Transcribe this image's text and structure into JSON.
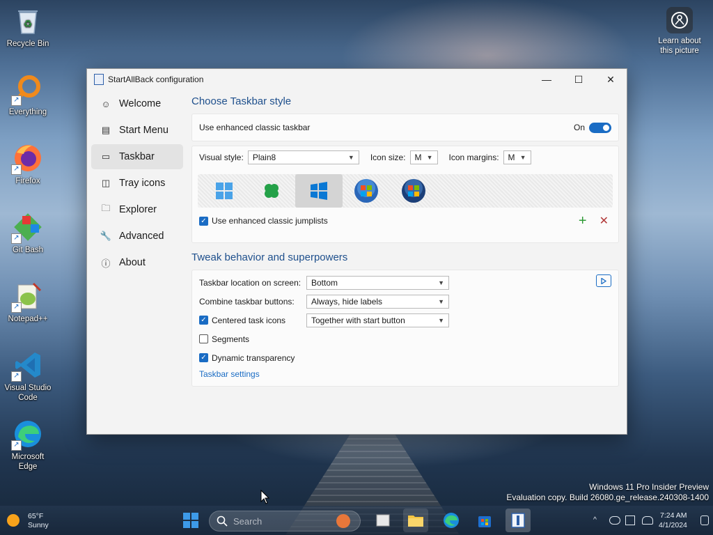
{
  "desktop": {
    "icons": [
      {
        "label": "Recycle Bin"
      },
      {
        "label": "Everything"
      },
      {
        "label": "Firefox"
      },
      {
        "label": "Git Bash"
      },
      {
        "label": "Notepad++"
      },
      {
        "label": "Visual Studio Code"
      },
      {
        "label": "Microsoft Edge"
      }
    ],
    "learn_label": "Learn about this picture",
    "watermark_line1": "Windows 11 Pro Insider Preview",
    "watermark_line2": "Evaluation copy. Build 26080.ge_release.240308-1400"
  },
  "window": {
    "title": "StartAllBack configuration",
    "controls": {
      "minimize": "—",
      "maximize": "☐",
      "close": "✕"
    },
    "nav": [
      {
        "label": "Welcome",
        "icon": "smile-icon",
        "glyph": "☺"
      },
      {
        "label": "Start Menu",
        "icon": "start-menu-icon",
        "glyph": "▤"
      },
      {
        "label": "Taskbar",
        "icon": "taskbar-icon",
        "glyph": "▭"
      },
      {
        "label": "Tray icons",
        "icon": "tray-icon",
        "glyph": "◫"
      },
      {
        "label": "Explorer",
        "icon": "folder-icon",
        "glyph": "🗀"
      },
      {
        "label": "Advanced",
        "icon": "wrench-icon",
        "glyph": "🔧"
      },
      {
        "label": "About",
        "icon": "info-icon",
        "glyph": "ⓘ"
      }
    ],
    "selected_nav": "Taskbar",
    "section1_title": "Choose Taskbar style",
    "enhanced_label": "Use enhanced classic taskbar",
    "enhanced_state": "On",
    "visual_style_label": "Visual style:",
    "visual_style_value": "Plain8",
    "icon_size_label": "Icon size:",
    "icon_size_value": "M",
    "icon_margins_label": "Icon margins:",
    "icon_margins_value": "M",
    "jumplists_label": "Use enhanced classic jumplists",
    "jumplists_checked": true,
    "add_glyph": "+",
    "remove_glyph": "✕",
    "section2_title": "Tweak behavior and superpowers",
    "location_label": "Taskbar location on screen:",
    "location_value": "Bottom",
    "combine_label": "Combine taskbar buttons:",
    "combine_value": "Always, hide labels",
    "centered_label": "Centered task icons",
    "centered_checked": true,
    "centered_value": "Together with start button",
    "segments_label": "Segments",
    "segments_checked": false,
    "dynamic_label": "Dynamic transparency",
    "dynamic_checked": true,
    "taskbar_settings_link": "Taskbar settings"
  },
  "taskbar": {
    "weather_temp": "65°F",
    "weather_desc": "Sunny",
    "search_placeholder": "Search",
    "clock_time": "7:24 AM",
    "clock_date": "4/1/2024"
  },
  "colors": {
    "accent": "#1a6cc4",
    "heading": "#1e4f8c",
    "add_green": "#2e9a35",
    "remove_red": "#b23a3a"
  }
}
